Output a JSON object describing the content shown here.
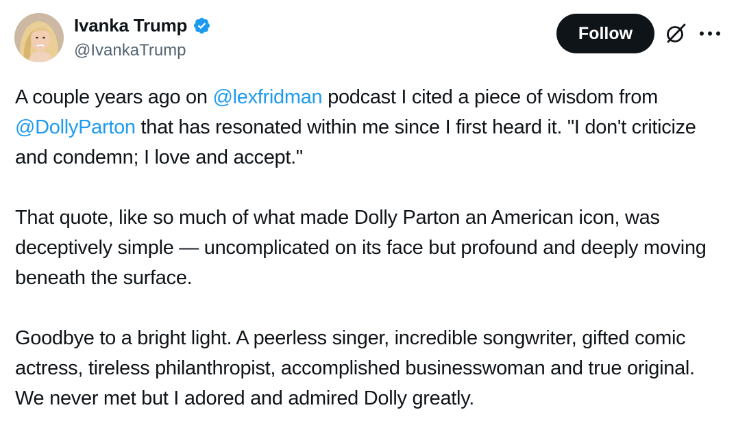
{
  "author": {
    "display_name": "Ivanka Trump",
    "handle": "@IvankaTrump",
    "verified": true,
    "avatar": "profile-photo"
  },
  "actions": {
    "follow_label": "Follow",
    "grok_icon": "grok-icon",
    "more_icon": "more-options-icon"
  },
  "colors": {
    "mention": "#1d9bf0",
    "text": "#0f1419",
    "secondary_text": "#536471",
    "follow_bg": "#0f1419",
    "verified_badge": "#1d9bf0"
  },
  "tweet": {
    "p1_a": "A couple years ago on ",
    "p1_mention1": "@lexfridman",
    "p1_b": " podcast I cited a piece of wisdom from ",
    "p1_mention2": "@DollyParton",
    "p1_c": " that has resonated within me since I first heard it. \"I don't criticize and condemn; I love and accept.\"",
    "p2": "That quote, like so much of what made Dolly Parton an American icon, was deceptively simple — uncomplicated on its face but profound and deeply moving beneath the surface.",
    "p3": "Goodbye to a bright light. A peerless singer, incredible songwriter, gifted comic actress, tireless philanthropist, accomplished businesswoman and true original. We never met but I adored and admired Dolly greatly."
  }
}
